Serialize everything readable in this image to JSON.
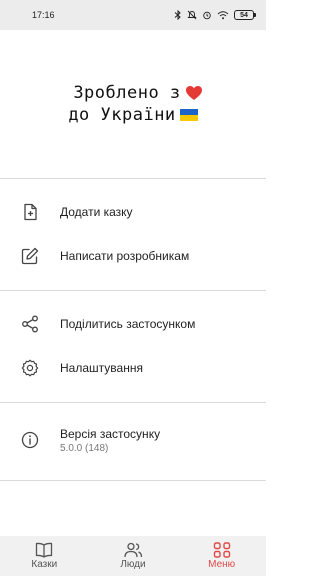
{
  "status_bar": {
    "time": "17:16",
    "battery": "54"
  },
  "banner": {
    "line1": "Зроблено з",
    "line1_emoji": "❤️",
    "line2": "до України",
    "line2_emoji": "🇺🇦"
  },
  "menu": {
    "add_story": "Додати казку",
    "write_devs": "Написати розробникам",
    "share_app": "Поділитись застосунком",
    "settings": "Налаштування",
    "version_label": "Версія застосунку",
    "version_value": "5.0.0 (148)"
  },
  "bottom_nav": {
    "items": [
      {
        "label": "Казки",
        "icon": "book-icon",
        "active": false
      },
      {
        "label": "Люди",
        "icon": "people-icon",
        "active": false
      },
      {
        "label": "Меню",
        "icon": "grid-icon",
        "active": true
      }
    ]
  },
  "colors": {
    "accent": "#e04a4a",
    "heart": "#e53935",
    "flag_blue": "#1e63c8",
    "flag_yellow": "#f7c800"
  }
}
